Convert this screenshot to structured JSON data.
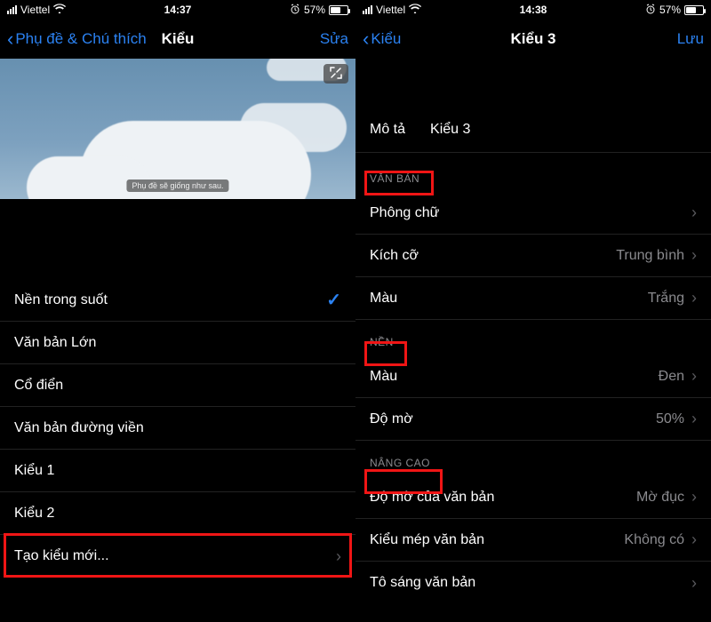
{
  "left": {
    "status": {
      "carrier": "Viettel",
      "time": "14:37",
      "battery_pct": "57%"
    },
    "nav": {
      "back": "Phụ đề & Chú thích",
      "title": "Kiểu",
      "action": "Sửa"
    },
    "preview": {
      "caption": "Phụ đề sẽ giống như sau."
    },
    "styles": [
      {
        "label": "Nền trong suốt",
        "selected": true
      },
      {
        "label": "Văn bản Lớn",
        "selected": false
      },
      {
        "label": "Cổ điển",
        "selected": false
      },
      {
        "label": "Văn bản đường viền",
        "selected": false
      },
      {
        "label": "Kiểu 1",
        "selected": false
      },
      {
        "label": "Kiểu 2",
        "selected": false
      }
    ],
    "create_label": "Tạo kiểu mới..."
  },
  "right": {
    "status": {
      "carrier": "Viettel",
      "time": "14:38",
      "battery_pct": "57%"
    },
    "nav": {
      "back": "Kiểu",
      "title": "Kiểu 3",
      "action": "Lưu"
    },
    "desc": {
      "label": "Mô tả",
      "value": "Kiểu 3"
    },
    "sections": {
      "text": {
        "header": "VĂN BẢN",
        "rows": [
          {
            "label": "Phông chữ",
            "value": ""
          },
          {
            "label": "Kích cỡ",
            "value": "Trung bình"
          },
          {
            "label": "Màu",
            "value": "Trắng"
          }
        ]
      },
      "bg": {
        "header": "NỀN",
        "rows": [
          {
            "label": "Màu",
            "value": "Đen"
          },
          {
            "label": "Độ mờ",
            "value": "50%"
          }
        ]
      },
      "adv": {
        "header": "NÂNG CAO",
        "rows": [
          {
            "label": "Độ mờ của văn bản",
            "value": "Mờ đục"
          },
          {
            "label": "Kiểu mép văn bản",
            "value": "Không có"
          },
          {
            "label": "Tô sáng văn bản",
            "value": ""
          }
        ]
      }
    }
  }
}
